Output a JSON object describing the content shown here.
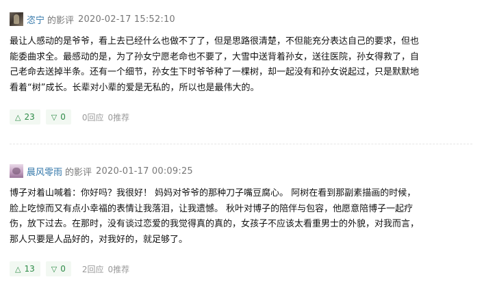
{
  "reviews": [
    {
      "username": "恣宁",
      "type_label": "的影评",
      "time": "2020-02-17 15:52:10",
      "content_lines": [
        "最让人感动的是爷爷，看上去已经什么也做不了了，但是思路很清楚，不但能充分表达自己的要求，但也",
        "能委曲求全。最感动的是，为了孙女宁愿老命也不要了，大雪中送背着孙女，送往医院，孙女得救了，自",
        "己老命去送掉半条。还有一个细节，孙女生下时爷爷种了一棵树，却一起没有和孙女说起过，只是默默地",
        "看着“树”成长。长辈对小辈的爱是无私的，所以也是最伟大的。"
      ],
      "useful_count": "23",
      "useless_count": "0",
      "reply_label": "0回应",
      "recommend_label": "0推荐"
    },
    {
      "username": "晨风零雨",
      "type_label": "的影评",
      "time": "2020-01-17 00:09:25",
      "content_lines": [
        "博子对着山喊着：你好吗？我很好！ 妈妈对爷爷的那种刀子嘴豆腐心。 阿树在看到那副素描画的时候，",
        "脸上吃惊而又有点小幸福的表情让我落泪，让我遗憾。 秋叶对博子的陪伴与包容，他愿意陪博子一起疗",
        "伤，放下过去。在那时，没有谈过恋爱的我觉得真的真的，女孩子不应该太看重男士的外貌，对我而言，",
        "那人只要是人品好的，对我好的，就足够了。"
      ],
      "useful_count": "13",
      "useless_count": "0",
      "reply_label": "2回应",
      "recommend_label": "0推荐"
    }
  ],
  "icons": {
    "useful": "triangle-up-icon",
    "useless": "triangle-down-icon"
  },
  "colors": {
    "username": "#3377aa",
    "vote_bg": "#f2f8f2",
    "vote_text": "#2c8a46",
    "meta_gray": "#777777",
    "muted": "#999999"
  }
}
